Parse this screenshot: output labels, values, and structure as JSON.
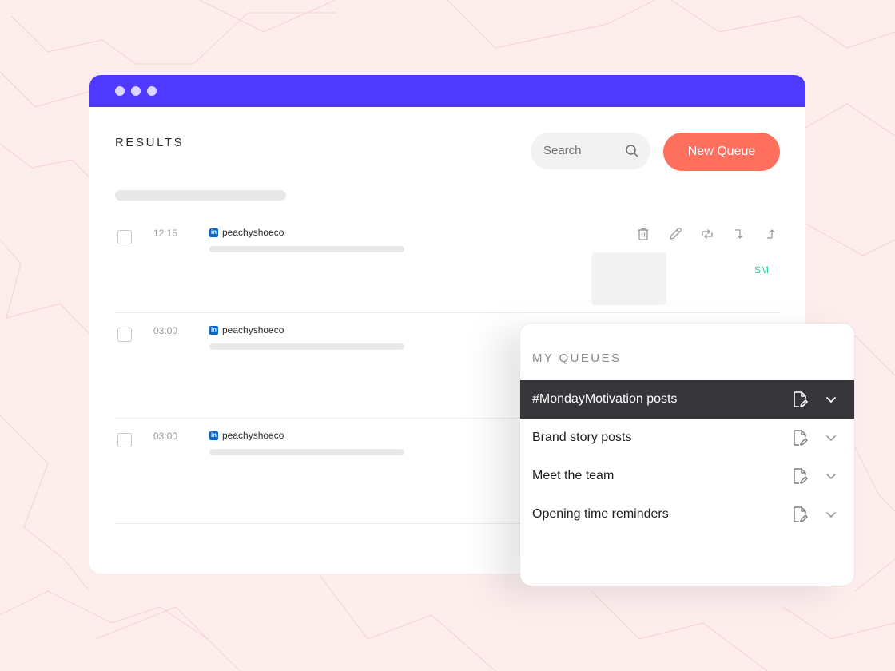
{
  "colors": {
    "background": "#fdeeed",
    "titlebar": "#5039ff",
    "accent_button": "#ff6f5e",
    "active_queue": "#36353a",
    "initials": "#2ecf8f",
    "linkedin": "#0a66c2"
  },
  "window": {
    "dots": [
      "dot",
      "dot",
      "dot"
    ]
  },
  "results": {
    "title": "RESULTS",
    "search_placeholder": "Search",
    "new_queue_label": "New Queue",
    "posts": [
      {
        "time": "12:15",
        "network_icon": "linkedin-icon",
        "network_glyph": "in",
        "account": "peachyshoeco",
        "initials": "SM",
        "actions": [
          "trash-icon",
          "pencil-icon",
          "repost-icon",
          "move-down-icon",
          "move-up-icon"
        ]
      },
      {
        "time": "03:00",
        "network_icon": "linkedin-icon",
        "network_glyph": "in",
        "account": "peachyshoeco"
      },
      {
        "time": "03:00",
        "network_icon": "linkedin-icon",
        "network_glyph": "in",
        "account": "peachyshoeco"
      }
    ]
  },
  "queues": {
    "title": "MY QUEUES",
    "items": [
      {
        "label": "#MondayMotivation posts",
        "active": true
      },
      {
        "label": "Brand story posts",
        "active": false
      },
      {
        "label": "Meet the team",
        "active": false
      },
      {
        "label": "Opening time reminders",
        "active": false
      }
    ]
  }
}
